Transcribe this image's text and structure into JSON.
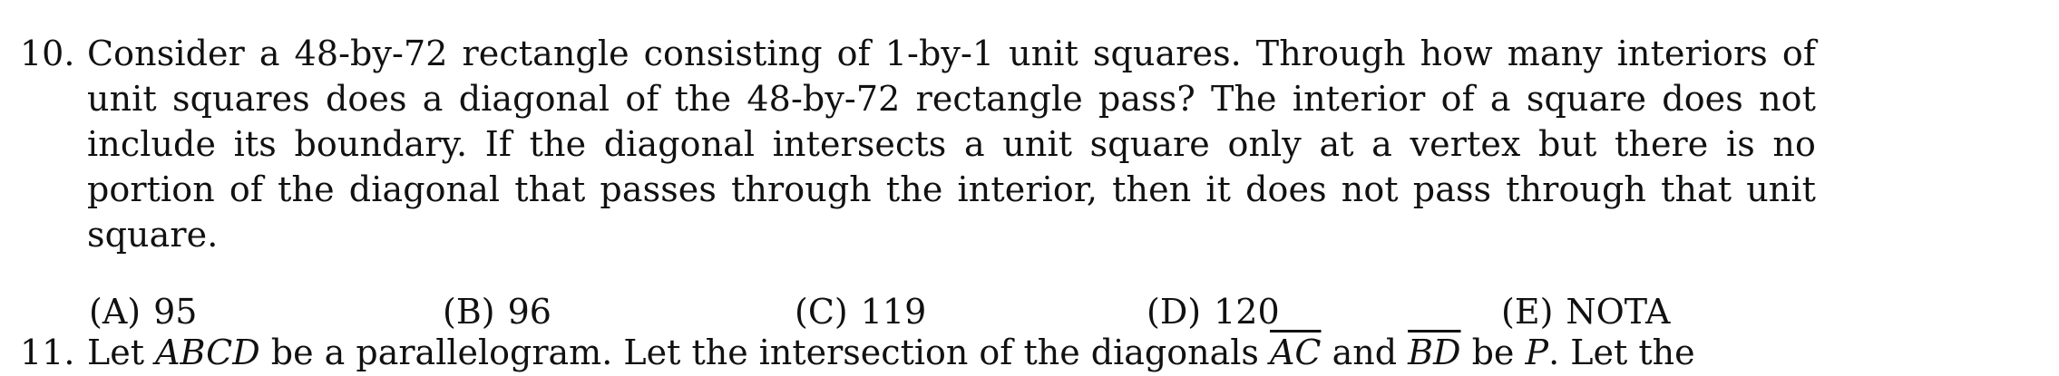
{
  "problem": {
    "number": "10.",
    "text": "Consider a 48-by-72 rectangle consisting of 1-by-1 unit squares. Through how many interiors of unit squares does a diagonal of the 48-by-72 rectangle pass? The interior of a square does not include its boundary. If the diagonal intersects a unit square only at a vertex but there is no portion of the diagonal that passes through the interior, then it does not pass through that unit square.",
    "choices": [
      {
        "letter": "(A)",
        "value": "95"
      },
      {
        "letter": "(B)",
        "value": "96"
      },
      {
        "letter": "(C)",
        "value": "119"
      },
      {
        "letter": "(D)",
        "value": "120"
      },
      {
        "letter": "(E)",
        "value": "NOTA"
      }
    ]
  },
  "next_problem": {
    "number": "11.",
    "text_start": "Let ",
    "figure_name": "ABCD",
    "text_mid": " be a parallelogram. Let the intersection of the diagonals ",
    "diag1": "AC",
    "text_and": " and ",
    "diag2": "BD",
    "text_be": " be ",
    "point": "P",
    "text_end": ". Let the"
  }
}
